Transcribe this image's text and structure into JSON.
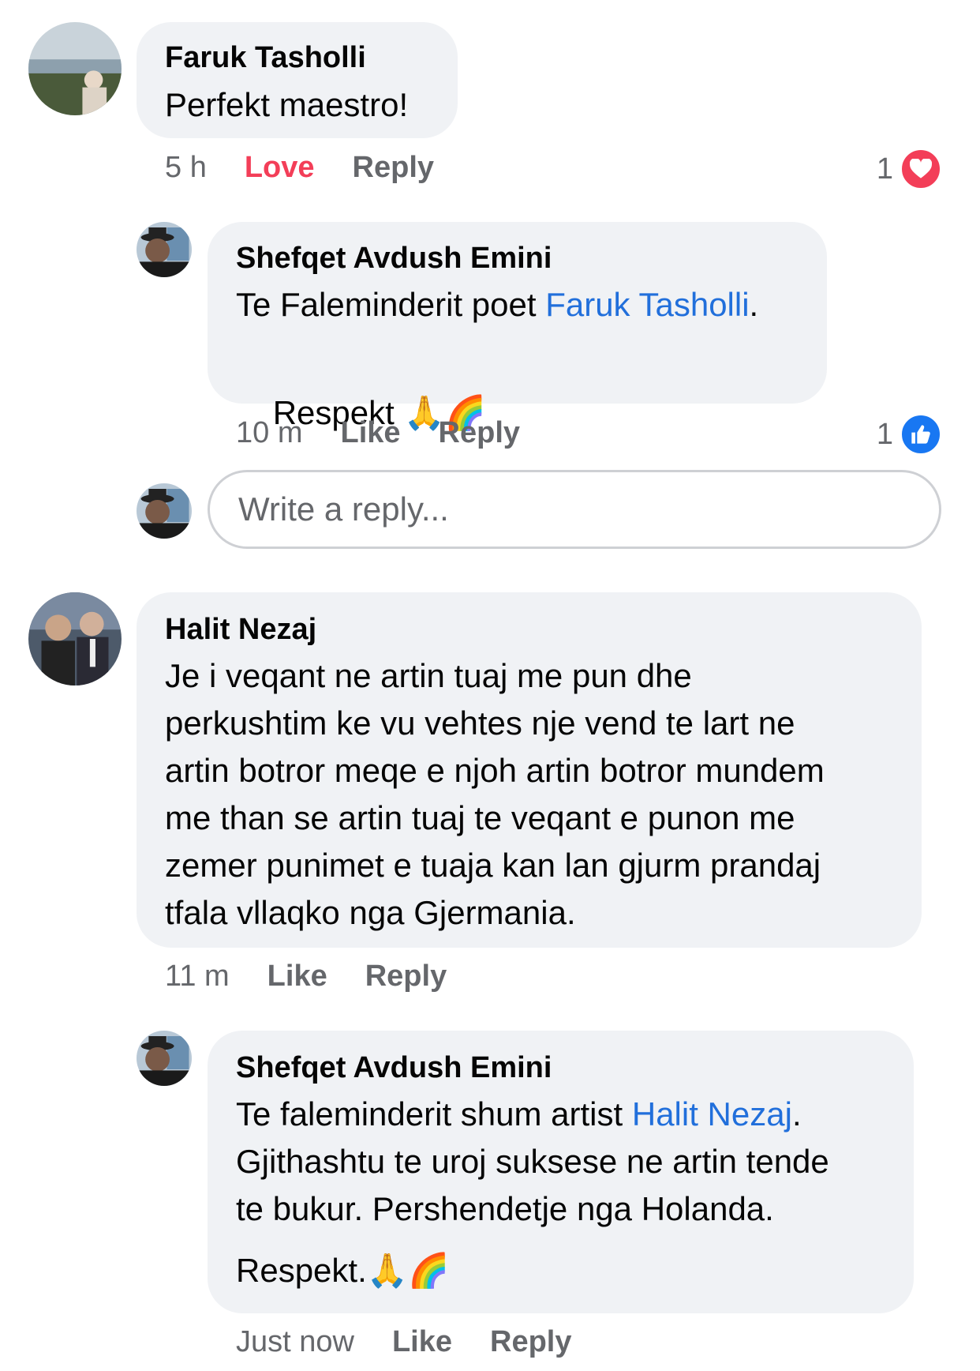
{
  "comments": [
    {
      "author": "Faruk Tasholli",
      "text": "Perfekt maestro!",
      "time": "5 h",
      "action1": "Love",
      "action2": "Reply",
      "reaction_count": "1",
      "reaction": "love-icon",
      "reaction_color": "#f33e58"
    },
    {
      "author": "Shefqet Avdush Emini",
      "text_prefix": "Te Faleminderit poet ",
      "mention": "Faruk Tasholli",
      "text_suffix": ".",
      "line2": "Respekt ",
      "emojis": "🙏🌈",
      "time": "10 m",
      "action1": "Like",
      "action2": "Reply",
      "reaction_count": "1",
      "reaction": "like-icon",
      "reaction_color": "#1877f2"
    },
    {
      "author": "Halit Nezaj",
      "lines": [
        "Je i veqant ne artin tuaj me pun dhe",
        "perkushtim ke vu vehtes nje vend te lart ne",
        "artin botror meqe e njoh artin botror mundem",
        "me than se artin tuaj te veqant e punon me",
        "zemer punimet e tuaja kan lan gjurm prandaj",
        "tfala vllaqko nga Gjermania."
      ],
      "time": "11 m",
      "action1": "Like",
      "action2": "Reply"
    },
    {
      "author": "Shefqet Avdush Emini",
      "text_prefix": "Te faleminderit shum artist ",
      "mention": "Halit Nezaj",
      "text_suffix": ".",
      "lines": [
        "Gjithashtu te uroj suksese ne artin tende",
        "te bukur. Pershendetje nga Holanda."
      ],
      "line_last": "Respekt.",
      "emojis": "🙏🌈",
      "time": "Just now",
      "action1": "Like",
      "action2": "Reply"
    }
  ],
  "reply_box": {
    "placeholder": "Write a reply..."
  }
}
